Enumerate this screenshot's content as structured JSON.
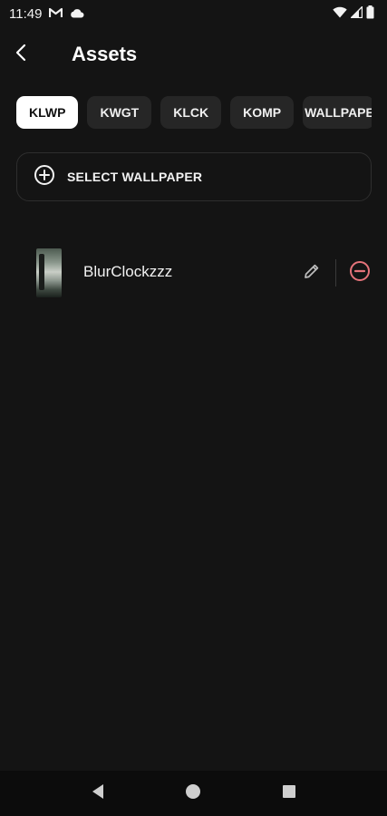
{
  "status_bar": {
    "time": "11:49",
    "icons": [
      "gmail-icon",
      "cloud-icon",
      "wifi-icon",
      "signal-icon",
      "battery-icon"
    ]
  },
  "header": {
    "title": "Assets",
    "back_icon": "chevron-left-icon"
  },
  "tabs": [
    {
      "label": "KLWP",
      "active": true
    },
    {
      "label": "KWGT",
      "active": false
    },
    {
      "label": "KLCK",
      "active": false
    },
    {
      "label": "KOMP",
      "active": false
    },
    {
      "label": "WALLPAPE",
      "active": false
    }
  ],
  "select_button": {
    "label": "SELECT WALLPAPER",
    "icon": "add-circle-icon"
  },
  "assets": [
    {
      "name": "BlurClockzzz",
      "actions": [
        "edit-icon",
        "remove-icon"
      ]
    }
  ],
  "nav": {
    "buttons": [
      "back-triangle-icon",
      "home-circle-icon",
      "recents-square-icon"
    ]
  },
  "colors": {
    "background": "#141414",
    "chip": "#262626",
    "chip_active": "#ffffff",
    "remove_accent": "#e5737a"
  }
}
